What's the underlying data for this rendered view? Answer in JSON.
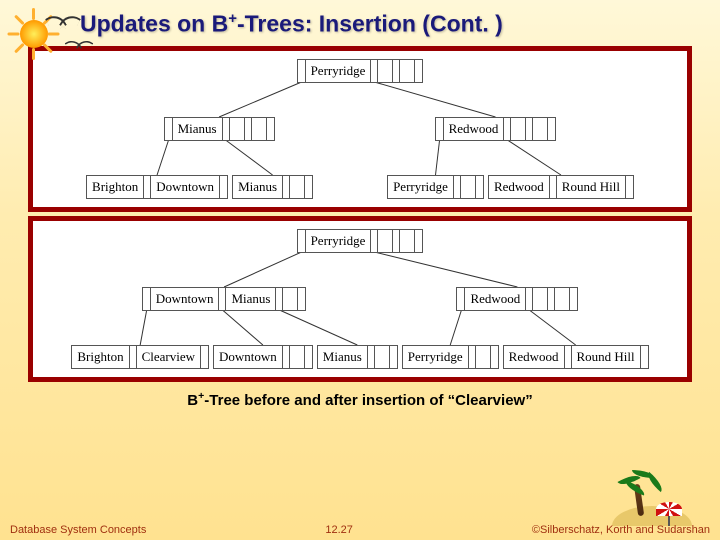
{
  "title_pre": "Updates on B",
  "title_sup": "+",
  "title_post": "-Trees:  Insertion (Cont. )",
  "tree_before": {
    "root": [
      "Perryridge"
    ],
    "internal": [
      {
        "keys": [
          "Mianus"
        ]
      },
      {
        "keys": [
          "Redwood"
        ]
      }
    ],
    "leaves": [
      {
        "keys": [
          "Brighton",
          "Downtown"
        ]
      },
      {
        "keys": [
          "Mianus"
        ]
      },
      {
        "keys": [
          "Perryridge"
        ]
      },
      {
        "keys": [
          "Redwood",
          "Round Hill"
        ]
      }
    ]
  },
  "tree_after": {
    "root": [
      "Perryridge"
    ],
    "internal": [
      {
        "keys": [
          "Downtown",
          "Mianus"
        ]
      },
      {
        "keys": [
          "Redwood"
        ]
      }
    ],
    "leaves": [
      {
        "keys": [
          "Brighton",
          "Clearview"
        ]
      },
      {
        "keys": [
          "Downtown"
        ]
      },
      {
        "keys": [
          "Mianus"
        ]
      },
      {
        "keys": [
          "Perryridge"
        ]
      },
      {
        "keys": [
          "Redwood",
          "Round Hill"
        ]
      }
    ]
  },
  "caption_pre": "B",
  "caption_sup": "+",
  "caption_post": "-Tree before and after insertion of “Clearview”",
  "footer_left": "Database System Concepts",
  "footer_page": "12.27",
  "footer_right": "©Silberschatz, Korth and Sudarshan"
}
